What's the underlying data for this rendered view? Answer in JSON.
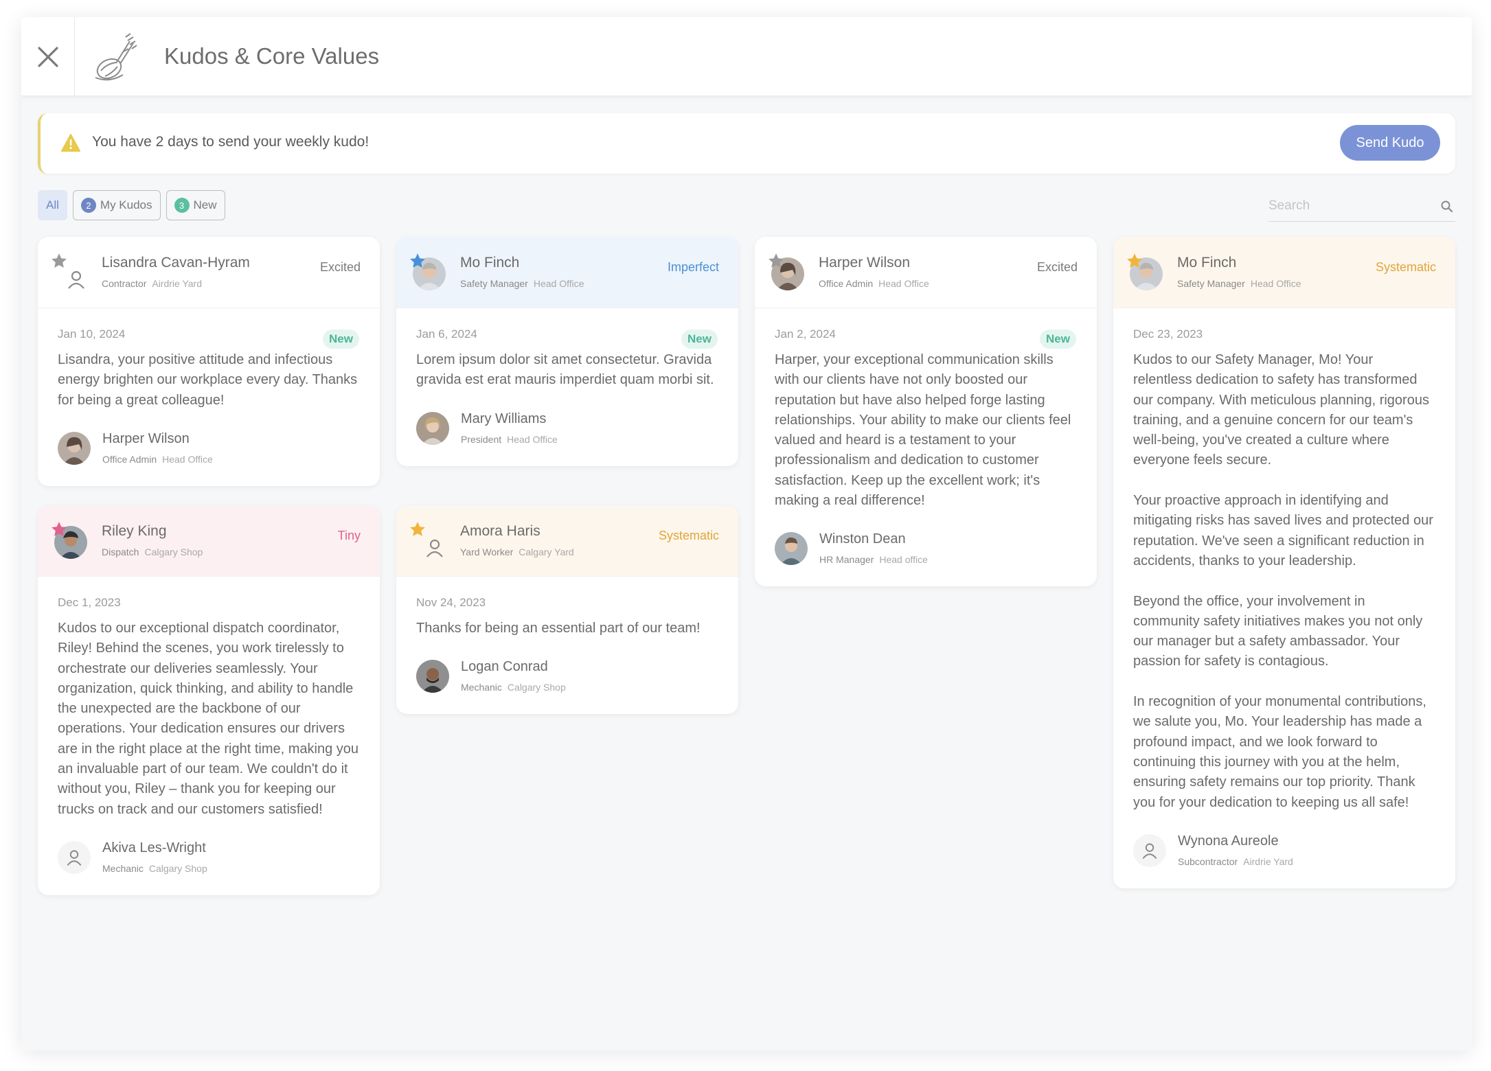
{
  "header": {
    "title": "Kudos & Core Values"
  },
  "alert": {
    "message": "You have 2 days to send your weekly kudo!",
    "button_label": "Send Kudo"
  },
  "filters": {
    "all_label": "All",
    "my_kudos_label": "My Kudos",
    "my_kudos_count": "2",
    "new_label": "New",
    "new_count": "3"
  },
  "search": {
    "placeholder": "Search"
  },
  "colors": {
    "accent_blue": "#7b93d6",
    "new_green": "#4db596",
    "excited": "#7a7a7a",
    "imperfect": "#4a90d9",
    "systematic": "#e0a63a",
    "tiny": "#e0608e"
  },
  "cards": [
    {
      "recipient": "Lisandra Cavan-Hyram",
      "role": "Contractor",
      "location": "Airdrie Yard",
      "value": "Excited",
      "date": "Jan 10, 2024",
      "badge": "New",
      "message": "Lisandra, your positive attitude and infectious energy brighten our workplace every day. Thanks for being a great colleague!",
      "sender": "Harper Wilson",
      "sender_role": "Office Admin",
      "sender_location": "Head Office"
    },
    {
      "recipient": "Mo Finch",
      "role": "Safety Manager",
      "location": "Head Office",
      "value": "Imperfect",
      "date": "Jan 6, 2024",
      "badge": "New",
      "message": "Lorem ipsum dolor sit amet consectetur. Gravida gravida est erat mauris imperdiet quam morbi sit.",
      "sender": "Mary Williams",
      "sender_role": "President",
      "sender_location": "Head Office"
    },
    {
      "recipient": "Harper Wilson",
      "role": "Office Admin",
      "location": "Head Office",
      "value": "Excited",
      "date": "Jan 2, 2024",
      "badge": "New",
      "message": "Harper, your exceptional communication skills with our clients have not only boosted our reputation but have also helped forge lasting relationships. Your ability to make our clients feel valued and heard is a testament to your professionalism and dedication to customer satisfaction. Keep up the excellent work; it's making a real difference!",
      "sender": "Winston Dean",
      "sender_role": "HR Manager",
      "sender_location": "Head office"
    },
    {
      "recipient": "Mo Finch",
      "role": "Safety Manager",
      "location": "Head Office",
      "value": "Systematic",
      "date": "Dec 23, 2023",
      "badge": "",
      "message": "Kudos to our Safety Manager, Mo! Your relentless dedication to safety has transformed our company. With meticulous planning, rigorous training, and a genuine concern for our team's well-being, you've created a culture where everyone feels secure.\n\nYour proactive approach in identifying and mitigating risks has saved lives and protected our reputation. We've seen a significant reduction in accidents, thanks to your leadership.\n\nBeyond the office, your involvement in community safety initiatives makes you not only our manager but a safety ambassador. Your passion for safety is contagious.\n\nIn recognition of your monumental contributions, we salute you, Mo. Your leadership has made a profound impact, and we look forward to continuing this journey with you at the helm, ensuring safety remains our top priority. Thank you for your dedication to keeping us all safe!",
      "sender": "Wynona Aureole",
      "sender_role": "Subcontractor",
      "sender_location": "Airdrie Yard"
    },
    {
      "recipient": "Riley King",
      "role": "Dispatch",
      "location": "Calgary Shop",
      "value": "Tiny",
      "date": "Dec 1, 2023",
      "badge": "",
      "message": "Kudos to our exceptional dispatch coordinator, Riley! Behind the scenes, you work tirelessly to orchestrate our deliveries seamlessly. Your organization, quick thinking, and ability to handle the unexpected are the backbone of our operations. Your dedication ensures our drivers are in the right place at the right time, making you an invaluable part of our team. We couldn't do it without you, Riley – thank you for keeping our trucks on track and our customers satisfied!",
      "sender": "Akiva Les-Wright",
      "sender_role": "Mechanic",
      "sender_location": "Calgary Shop"
    },
    {
      "recipient": "Amora Haris",
      "role": "Yard Worker",
      "location": "Calgary Yard",
      "value": "Systematic",
      "date": "Nov 24, 2023",
      "badge": "",
      "message": "Thanks for being an essential part of our team!",
      "sender": "Logan Conrad",
      "sender_role": "Mechanic",
      "sender_location": "Calgary Shop"
    }
  ]
}
